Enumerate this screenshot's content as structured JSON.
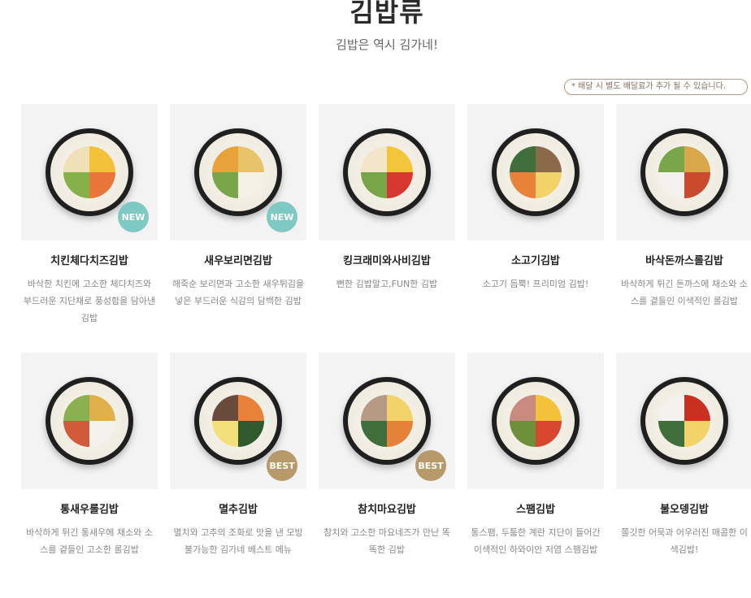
{
  "header": {
    "title": "김밥류",
    "subtitle": "김밥은 역시 김가네!",
    "notice": "* 배달 시 별도 배달료가 추가 될 수 있습니다."
  },
  "products": [
    {
      "name": "치킨체다치즈김밥",
      "desc": "바삭한 치킨에 고소한 체다치즈와 부드러운 지단채로 풍성함을 담아낸 김밥",
      "badge": "NEW",
      "badge_type": "new",
      "colors": [
        "#f3c23a",
        "#e9753a",
        "#86b04a",
        "#f0e0b8"
      ]
    },
    {
      "name": "새우보리면김밥",
      "desc": "해죽순 보리면과 고소한 새우튀김을 넣은 부드러운 식감의 담백한 김밥",
      "badge": "NEW",
      "badge_type": "new",
      "colors": [
        "#e8c36a",
        "#f5f0e4",
        "#7aa64a",
        "#e9a23a"
      ]
    },
    {
      "name": "킹크래미와사비김밥",
      "desc": "뻔한 김밥말고,FUN한 김밥",
      "badge": "",
      "badge_type": "",
      "colors": [
        "#f2c53a",
        "#d7372f",
        "#78a548",
        "#f3e6c8"
      ]
    },
    {
      "name": "소고기김밥",
      "desc": "소고기 듬뿍! 프리미엄 김밥!",
      "badge": "",
      "badge_type": "",
      "colors": [
        "#8a6a4a",
        "#f2d36a",
        "#e8813a",
        "#3f6e3a"
      ]
    },
    {
      "name": "바삭돈까스롤김밥",
      "desc": "바삭하게 튀긴 돈까스에 채소와 소스를 곁들인 이색적인 롤김밥",
      "badge": "",
      "badge_type": "",
      "colors": [
        "#d9a64a",
        "#c94a2f",
        "#f4f2ee",
        "#7aa64a"
      ]
    },
    {
      "name": "통새우롤김밥",
      "desc": "바삭하게 튀긴 통새우에 채소와 소스를 곁들인 고소한 롤김밥",
      "badge": "",
      "badge_type": "",
      "colors": [
        "#e0b04a",
        "#f4f2ee",
        "#d05a3a",
        "#8bb050"
      ]
    },
    {
      "name": "멸추김밥",
      "desc": "멸치와 고추의 조화로 맛을 낸 모방불가능한 김가네 베스트 메뉴",
      "badge": "BEST",
      "badge_type": "best",
      "colors": [
        "#e8813a",
        "#2f5a2e",
        "#f3e07a",
        "#6a4a3a"
      ]
    },
    {
      "name": "참치마요김밥",
      "desc": "참치와 고소한 마요네즈가 만난 똑똑한 김밥",
      "badge": "BEST",
      "badge_type": "best",
      "colors": [
        "#f2d36a",
        "#e6813a",
        "#3f6e3a",
        "#b69a86"
      ]
    },
    {
      "name": "스팸김밥",
      "desc": "통스팸, 두툼한 계란 지단이 들어간 이색적인 하와이안 저염 스팸김밥",
      "badge": "",
      "badge_type": "",
      "colors": [
        "#f3c23a",
        "#d7472f",
        "#6f8f3a",
        "#c98a80"
      ]
    },
    {
      "name": "불오뎅김밥",
      "desc": "쫄깃한 어묵과 어우러진 매콤한 이색김밥!",
      "badge": "",
      "badge_type": "",
      "colors": [
        "#c9301f",
        "#f2d36a",
        "#3f6e3a",
        "#f4f2ee"
      ]
    }
  ]
}
